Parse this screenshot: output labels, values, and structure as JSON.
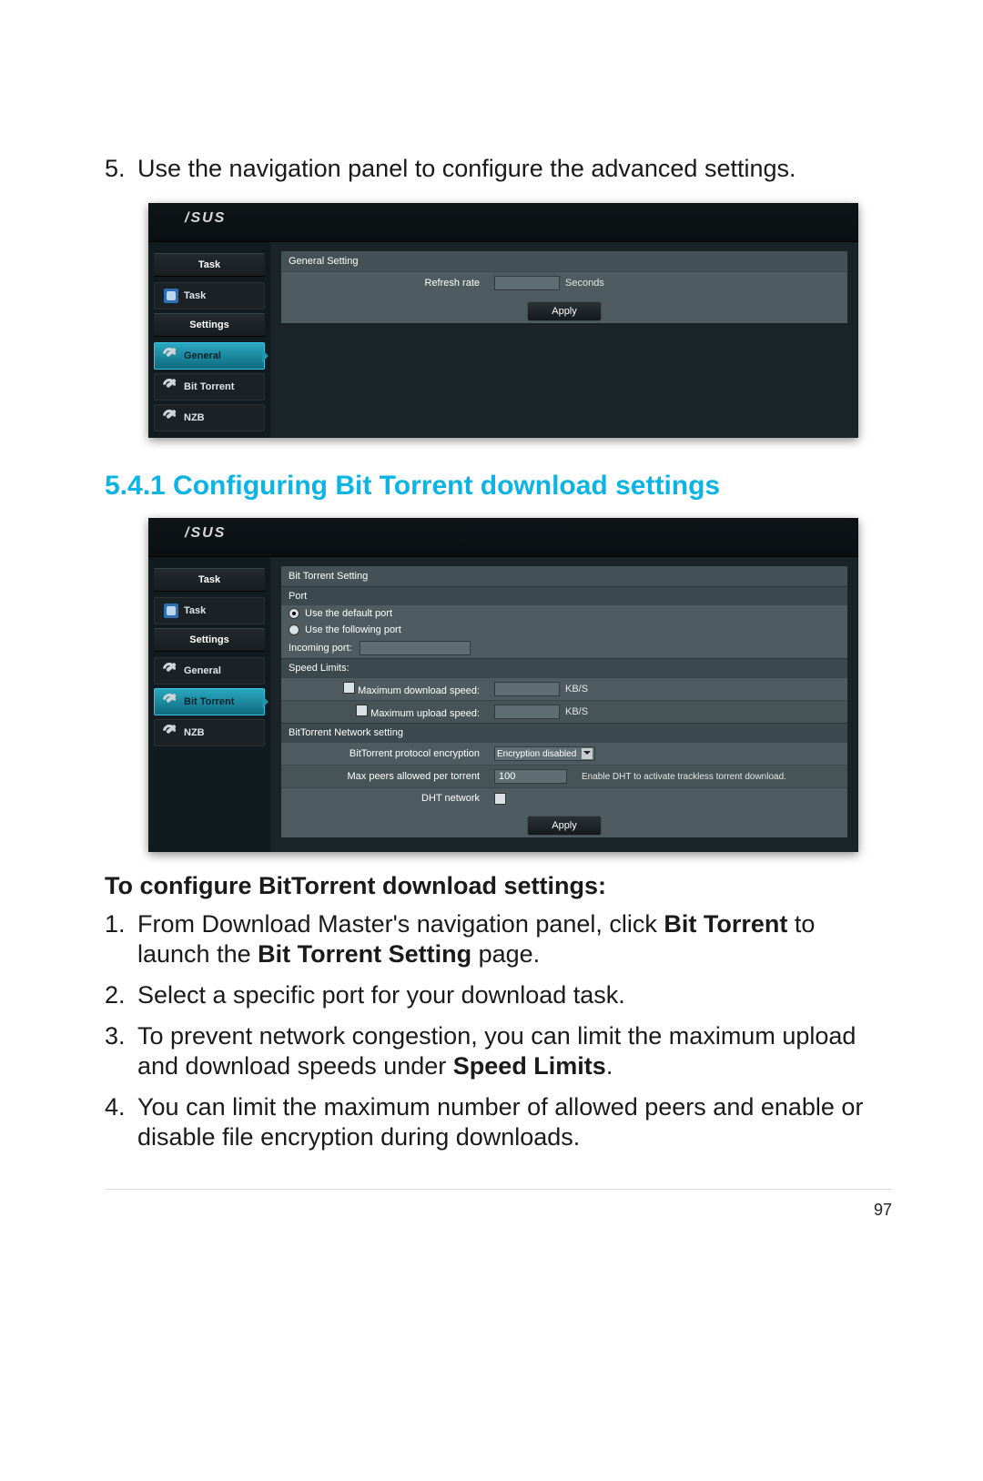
{
  "page_number": "97",
  "step5": {
    "num": "5.",
    "text": "Use the navigation panel to configure the advanced settings."
  },
  "section_heading": "5.4.1 Configuring Bit Torrent download settings",
  "subheading": "To configure BitTorrent download settings:",
  "steps": [
    {
      "num": "1.",
      "pre": "From Download Master's navigation panel, click ",
      "b1": "Bit Torrent",
      "mid": " to launch the ",
      "b2": "Bit Torrent Setting",
      "post": " page."
    },
    {
      "num": "2.",
      "pre": "Select a specific port for your download task.",
      "b1": "",
      "mid": "",
      "b2": "",
      "post": ""
    },
    {
      "num": "3.",
      "pre": "To prevent network congestion, you can limit the maximum upload and download speeds under ",
      "b1": "Speed Limits",
      "mid": ".",
      "b2": "",
      "post": ""
    },
    {
      "num": "4.",
      "pre": "You can limit the maximum number of allowed peers and enable or disable file encryption during downloads.",
      "b1": "",
      "mid": "",
      "b2": "",
      "post": ""
    }
  ],
  "ui": {
    "brand": "/SUS",
    "task_header": "Task",
    "settings_header": "Settings",
    "nav": {
      "task": "Task",
      "general": "General",
      "bittorrent": "Bit Torrent",
      "nzb": "NZB"
    },
    "apply": "Apply"
  },
  "shot1": {
    "panel_title": "General Setting",
    "refresh_label": "Refresh rate",
    "seconds": "Seconds"
  },
  "shot2": {
    "panel_title": "Bit Torrent Setting",
    "port_section": "Port",
    "radio1": "Use the default port",
    "radio2": "Use the following port",
    "incoming_port": "Incoming port:",
    "speed_section": "Speed Limits:",
    "max_dl": "Maximum download speed:",
    "max_ul": "Maximum upload speed:",
    "kbs": "KB/S",
    "net_section": "BitTorrent Network setting",
    "enc_label": "BitTorrent protocol encryption",
    "enc_value": "Encryption disabled",
    "peers_label": "Max peers allowed per torrent",
    "peers_value": "100",
    "dht_label": "DHT network",
    "dht_hint": "Enable DHT to activate trackless torrent download."
  }
}
